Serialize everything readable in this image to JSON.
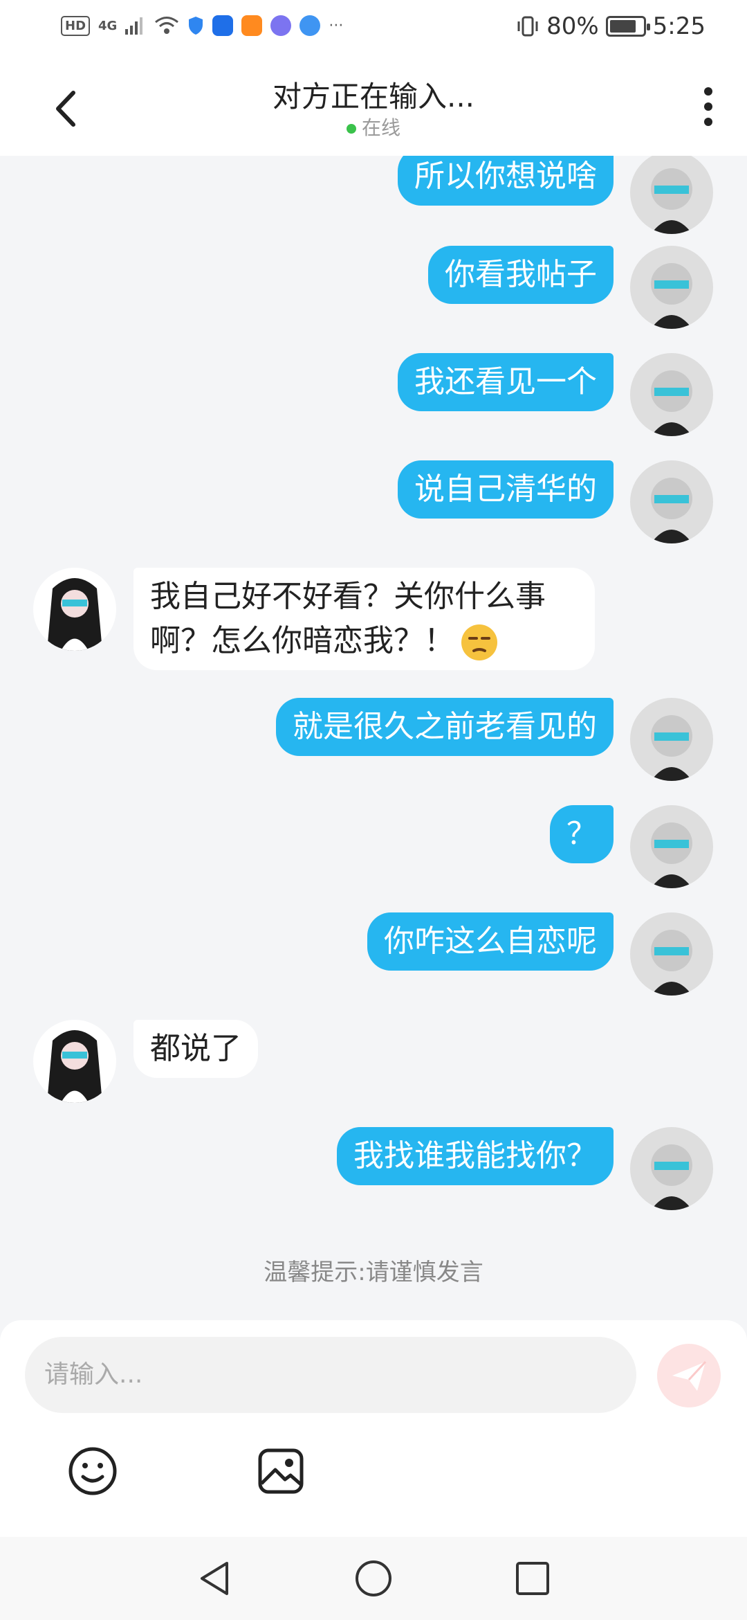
{
  "status_bar": {
    "hd": "HD",
    "network": "4G",
    "battery_percent": "80%",
    "battery_level": 0.8,
    "time": "5:25",
    "more": "···"
  },
  "header": {
    "title": "对方正在输入...",
    "status": "在线"
  },
  "messages": [
    {
      "side": "right",
      "text": "所以你想说啥"
    },
    {
      "side": "right",
      "text": "你看我帖子"
    },
    {
      "side": "right",
      "text": "我还看见一个"
    },
    {
      "side": "right",
      "text": "说自己清华的"
    },
    {
      "side": "left",
      "text": "我自己好不好看？关你什么事啊？怎么你暗恋我？！",
      "emoji": "unamused-face"
    },
    {
      "side": "right",
      "text": "就是很久之前老看见的"
    },
    {
      "side": "right",
      "text": "？"
    },
    {
      "side": "right",
      "text": "你咋这么自恋呢"
    },
    {
      "side": "left",
      "text": "都说了"
    },
    {
      "side": "right",
      "text": "我找谁我能找你？"
    }
  ],
  "tip": "温馨提示:请谨慎发言",
  "composer": {
    "placeholder": "请输入...",
    "send_icon": "paper-plane-icon",
    "emoji_icon": "smiley-icon",
    "image_icon": "image-icon"
  },
  "colors": {
    "accent": "#26b6f0",
    "online": "#3ac24b",
    "send_button": "#fde3e3"
  }
}
